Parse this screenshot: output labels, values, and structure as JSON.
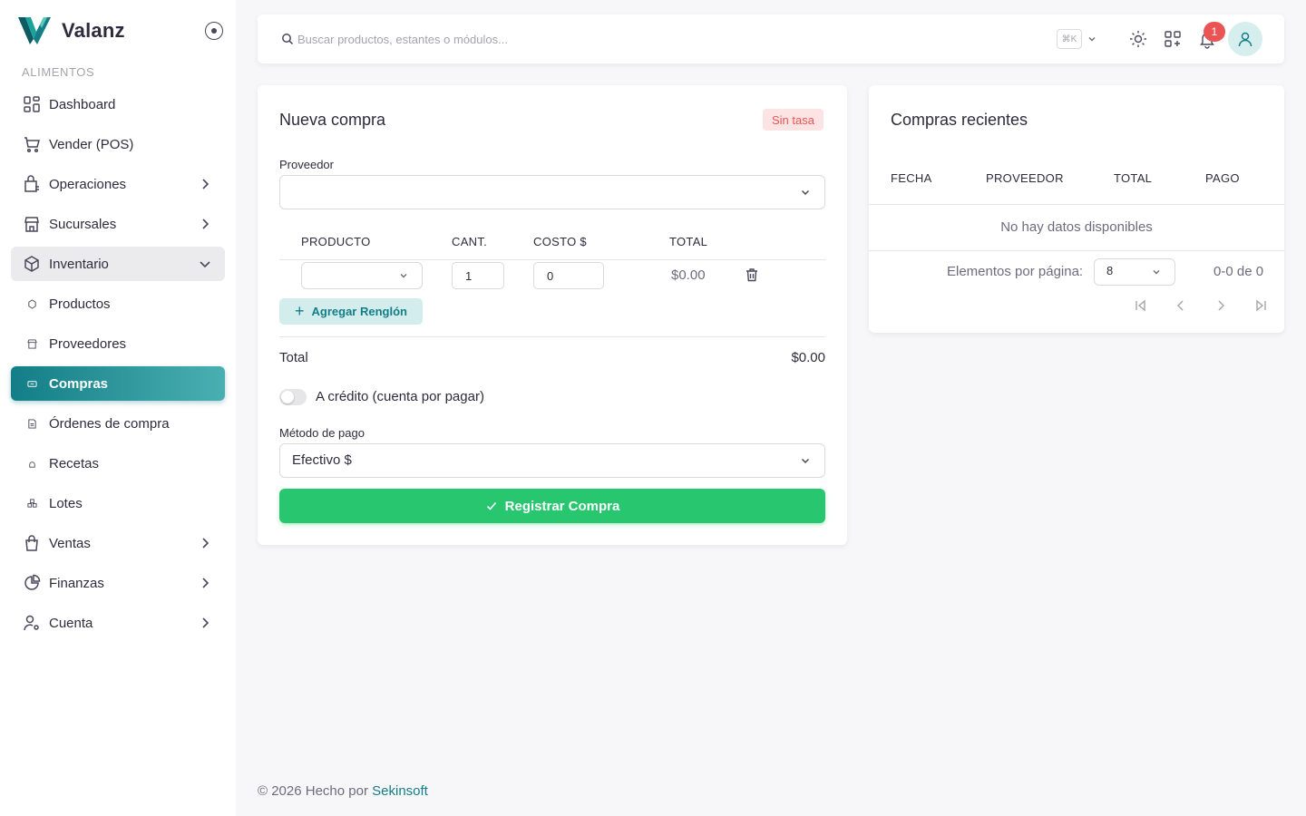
{
  "brand": {
    "name": "Valanz"
  },
  "sidebar": {
    "section_title": "ALIMENTOS",
    "items": [
      {
        "label": "Dashboard",
        "icon": "dashboard-icon"
      },
      {
        "label": "Vender (POS)",
        "icon": "cart-icon"
      },
      {
        "label": "Operaciones",
        "icon": "operations-icon",
        "expandable": true
      },
      {
        "label": "Sucursales",
        "icon": "store-icon",
        "expandable": true
      },
      {
        "label": "Inventario",
        "icon": "box-icon",
        "expanded": true
      },
      {
        "label": "Productos",
        "icon": "product-dot-icon"
      },
      {
        "label": "Proveedores",
        "icon": "supplier-dot-icon"
      },
      {
        "label": "Compras",
        "icon": "purchases-dot-icon",
        "active": true
      },
      {
        "label": "Órdenes de compra",
        "icon": "order-dot-icon"
      },
      {
        "label": "Recetas",
        "icon": "recipe-dot-icon"
      },
      {
        "label": "Lotes",
        "icon": "batch-dot-icon"
      },
      {
        "label": "Ventas",
        "icon": "bag-icon",
        "expandable": true
      },
      {
        "label": "Finanzas",
        "icon": "chart-pie-icon",
        "expandable": true
      },
      {
        "label": "Cuenta",
        "icon": "user-cog-icon",
        "expandable": true
      }
    ]
  },
  "topbar": {
    "search_placeholder": "Buscar productos, estantes o módulos...",
    "shortcut": "⌘K",
    "notification_count": "1"
  },
  "new_purchase": {
    "title": "Nueva compra",
    "rate_chip": "Sin tasa",
    "supplier_label": "Proveedor",
    "supplier_value": "",
    "columns": {
      "product": "PRODUCTO",
      "qty": "CANT.",
      "cost": "COSTO $",
      "total": "TOTAL"
    },
    "row": {
      "product": "",
      "qty": "1",
      "cost": "0",
      "total": "$0.00"
    },
    "add_row_label": "Agregar Renglón",
    "total_label": "Total",
    "total_value": "$0.00",
    "credit_label": "A crédito (cuenta por pagar)",
    "credit_enabled": false,
    "payment_method_label": "Método de pago",
    "payment_method_value": "Efectivo $",
    "submit_label": "Registrar Compra"
  },
  "recent_purchases": {
    "title": "Compras recientes",
    "columns": {
      "date": "FECHA",
      "supplier": "PROVEEDOR",
      "total": "TOTAL",
      "payment": "PAGO"
    },
    "empty_message": "No hay datos disponibles",
    "per_page_label": "Elementos por página:",
    "per_page_value": "8",
    "range_label": "0-0 de 0"
  },
  "footer": {
    "prefix": "© 2026 Hecho por",
    "link": "Sekinsoft"
  },
  "colors": {
    "accent": "#137e87",
    "success": "#28c76f",
    "danger": "#ea5455"
  }
}
